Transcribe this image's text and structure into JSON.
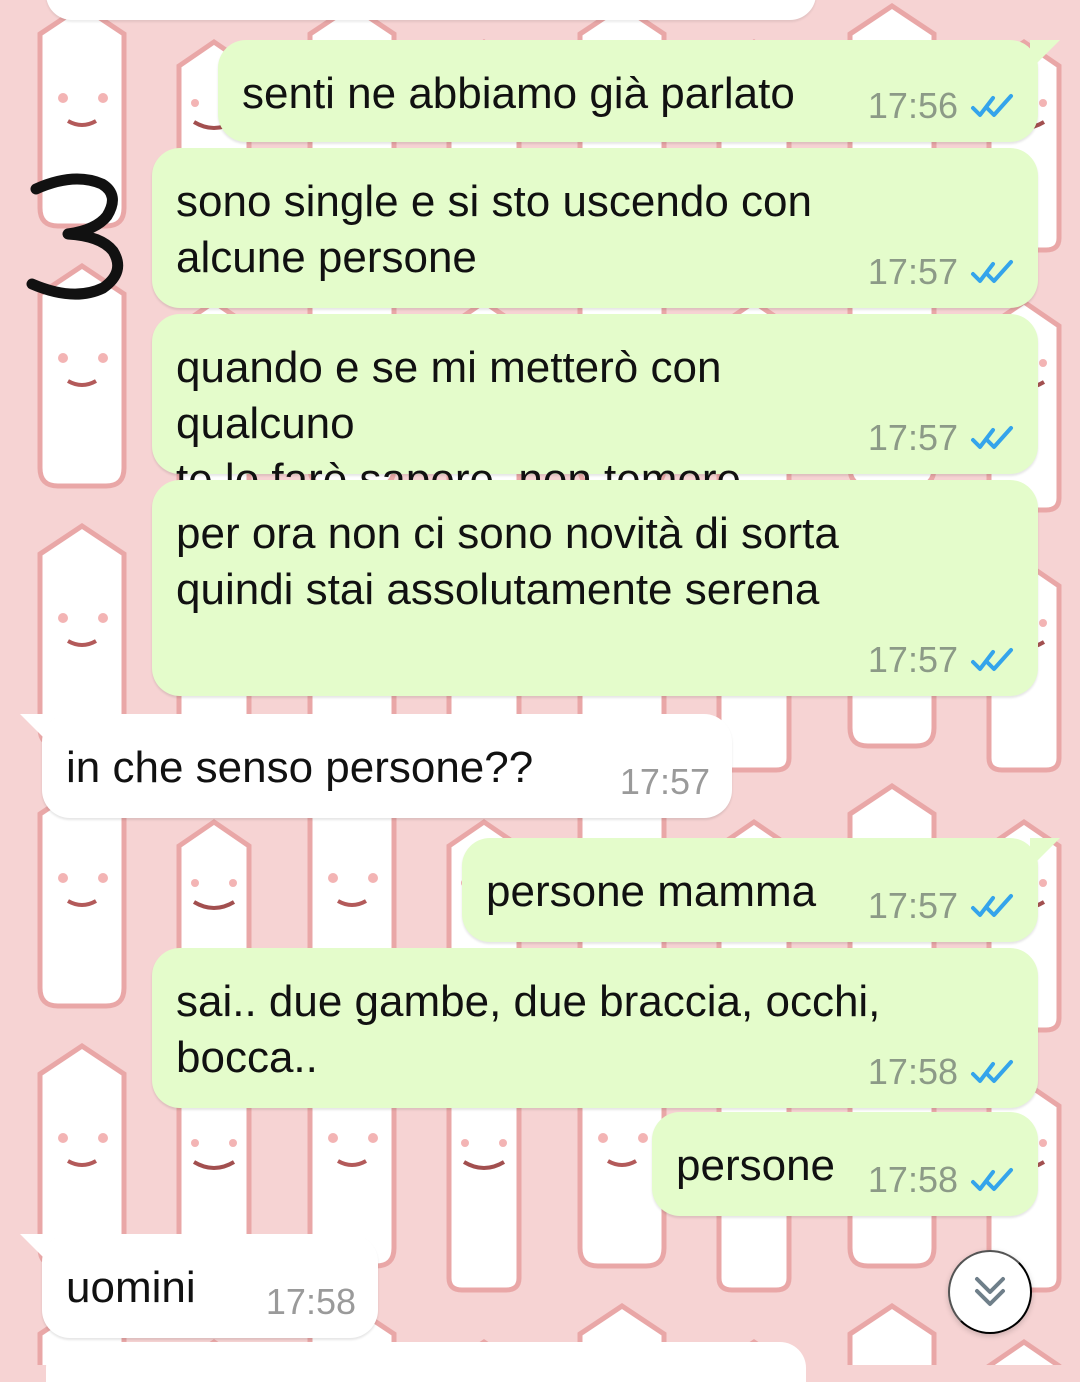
{
  "overlay": {
    "number": "3"
  },
  "messages": [
    {
      "direction": "out",
      "text": "senti ne abbiamo già parlato",
      "time": "17:56",
      "status_icon": "double-check-icon"
    },
    {
      "direction": "out",
      "text": "sono single e si sto uscendo con\nalcune persone",
      "time": "17:57",
      "status_icon": "double-check-icon"
    },
    {
      "direction": "out",
      "text": "quando e se mi metterò con qualcuno\nte lo farò sapere, non temere",
      "time": "17:57",
      "status_icon": "double-check-icon"
    },
    {
      "direction": "out",
      "text": "per ora non ci sono novità di sorta\nquindi stai assolutamente serena",
      "time": "17:57",
      "status_icon": "double-check-icon"
    },
    {
      "direction": "in",
      "text": "in che senso persone??",
      "time": "17:57"
    },
    {
      "direction": "out",
      "text": "persone mamma",
      "time": "17:57",
      "status_icon": "double-check-icon"
    },
    {
      "direction": "out",
      "text": "sai.. due gambe, due braccia, occhi,\nbocca..",
      "time": "17:58",
      "status_icon": "double-check-icon"
    },
    {
      "direction": "out",
      "text": "persone",
      "time": "17:58",
      "status_icon": "double-check-icon"
    },
    {
      "direction": "in",
      "text": "uomini",
      "time": "17:58"
    }
  ],
  "controls": {
    "scroll_down_icon": "chevron-double-down-icon"
  },
  "colors": {
    "wallpaper": "#f6d3d3",
    "outgoing_bubble": "#e4fccb",
    "incoming_bubble": "#ffffff",
    "read_check": "#34a4eb"
  }
}
